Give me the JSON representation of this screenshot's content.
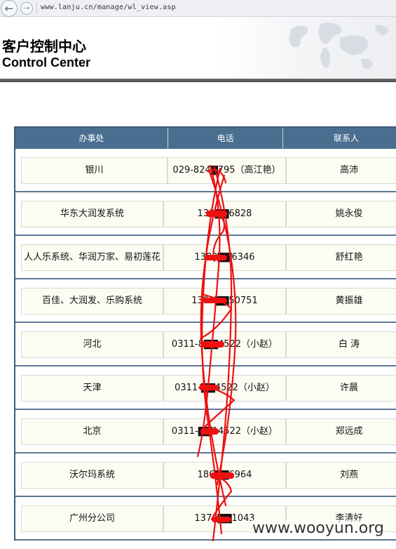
{
  "browser": {
    "url": "www.lanju.cn/manage/wl_view.asp",
    "back_icon": "arrow-left-icon",
    "forward_icon": "arrow-right-icon"
  },
  "header": {
    "title_cn": "客户控制中心",
    "title_en": "Control Center"
  },
  "table": {
    "columns": [
      "办事处",
      "电话",
      "联系人"
    ],
    "rows": [
      {
        "office": "银川",
        "phone": "029-824▇795（高江艳）",
        "contact": "高沛"
      },
      {
        "office": "华东大润发系统",
        "phone": "133▇▇6828",
        "contact": "姚永俊"
      },
      {
        "office": "人人乐系统、华润万家、易初莲花",
        "phone": "1382▇▇6346",
        "contact": "舒红艳"
      },
      {
        "office": "百佳、大润发、乐购系统",
        "phone": "1392▇▇50751",
        "contact": "黄振雄"
      },
      {
        "office": "河北",
        "phone": "0311-8▇▇4522（小赵）",
        "contact": "白 涛"
      },
      {
        "office": "天津",
        "phone": "0311-▇▇4522（小赵）",
        "contact": "许晨"
      },
      {
        "office": "北京",
        "phone": "0311-▇▇14522（小赵）",
        "contact": "郑远成"
      },
      {
        "office": "沃尔玛系统",
        "phone": "186▇▇6964",
        "contact": "刘燕"
      },
      {
        "office": "广州分公司",
        "phone": "1370▇▇1043",
        "contact": "李清好"
      }
    ]
  },
  "watermark": "www.wooyun.org",
  "colors": {
    "header_bar": "#4a6e8f",
    "row_divider": "#5a7794",
    "cell_bg": "#fdfcf3",
    "redaction": "#ee1111"
  }
}
